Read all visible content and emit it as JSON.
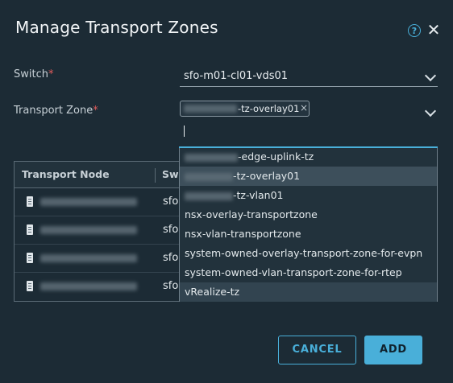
{
  "dialog": {
    "title": "Manage Transport Zones",
    "help_icon": "help-circle-icon",
    "close_icon": "close-icon"
  },
  "form": {
    "switch_label": "Switch",
    "switch_value": "sfo-m01-cl01-vds01",
    "transport_zone_label": "Transport Zone",
    "required_marker": "*",
    "selected_chip_suffix": "-tz-overlay01",
    "chip_remove": "×"
  },
  "table": {
    "columns": [
      "Transport Node",
      "Swi"
    ],
    "rows": [
      {
        "switch": "sfo"
      },
      {
        "switch": "sfo"
      },
      {
        "switch": "sfo"
      },
      {
        "switch": "sfo"
      }
    ],
    "row_icon": "server-icon"
  },
  "dropdown": {
    "options": [
      "-edge-uplink-tz",
      "-tz-overlay01",
      "-tz-vlan01",
      "nsx-overlay-transportzone",
      "nsx-vlan-transportzone",
      "system-owned-overlay-transport-zone-for-evpn",
      "system-owned-vlan-transport-zone-for-rtep",
      "vRealize-tz"
    ],
    "selected_index": 1,
    "hover_index": 7
  },
  "buttons": {
    "cancel": "CANCEL",
    "add": "ADD"
  },
  "colors": {
    "background": "#1c2b35",
    "accent": "#49afd9",
    "required": "#e25c5c"
  }
}
